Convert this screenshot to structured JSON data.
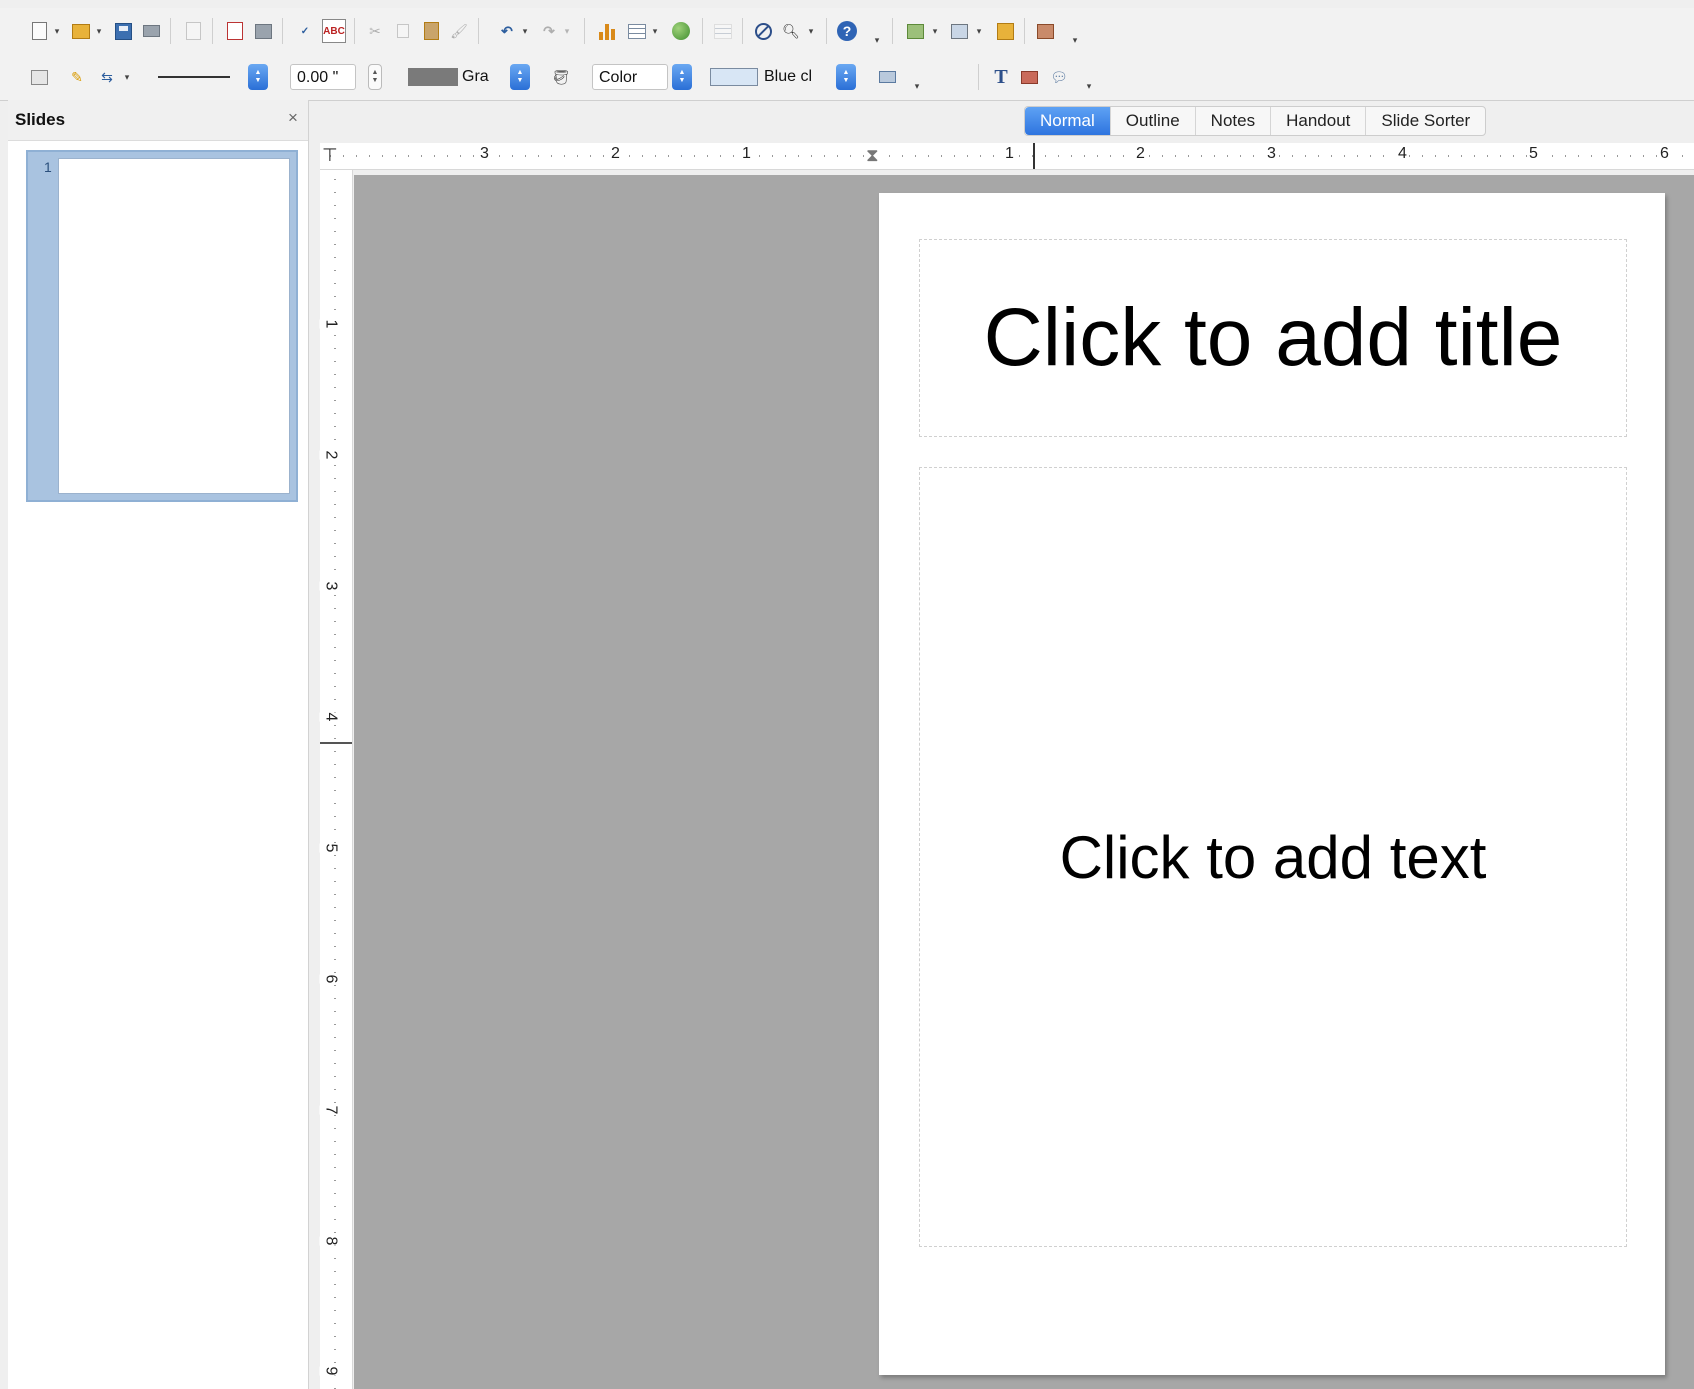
{
  "toolbar2": {
    "line_width_value": "0.00 \"",
    "line_color_value": "Gra",
    "area_style_value": "Color",
    "area_fill_value": "Blue cl"
  },
  "slides_panel": {
    "title": "Slides",
    "close_glyph": "×",
    "thumbnails": [
      {
        "number": "1"
      }
    ]
  },
  "view_tabs": [
    {
      "label": "Normal",
      "active": true
    },
    {
      "label": "Outline",
      "active": false
    },
    {
      "label": "Notes",
      "active": false
    },
    {
      "label": "Handout",
      "active": false
    },
    {
      "label": "Slide Sorter",
      "active": false
    }
  ],
  "h_ruler": {
    "labels": [
      "3",
      "2",
      "1",
      "1",
      "2",
      "3",
      "4",
      "5",
      "6"
    ]
  },
  "v_ruler": {
    "labels": [
      "1",
      "2",
      "3",
      "4",
      "5",
      "6",
      "7",
      "8",
      "9"
    ]
  },
  "slide": {
    "title_placeholder": "Click to add title",
    "body_placeholder": "Click to add text"
  },
  "colors": {
    "accent": "#2e74df",
    "workspace_gray": "#a7a7a7",
    "line_swatch": "#7a7a7a",
    "fill_swatch": "#d8e6f5"
  }
}
